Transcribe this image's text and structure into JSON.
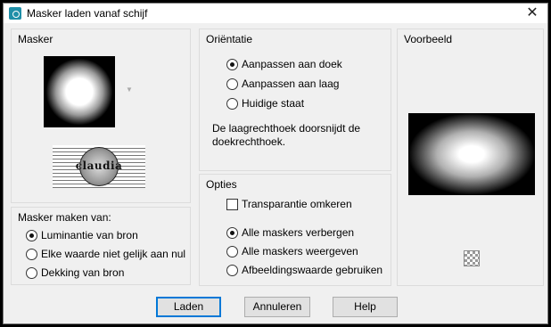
{
  "window": {
    "title": "Masker laden vanaf schijf",
    "close_symbol": "✕"
  },
  "mask_group": {
    "label": "Masker",
    "logo_text": "claudia"
  },
  "source_group": {
    "label": "Masker maken van:",
    "options": [
      "Luminantie van bron",
      "Elke waarde niet gelijk aan nul",
      "Dekking van bron"
    ],
    "selected": 0
  },
  "orientation_group": {
    "label": "Oriëntatie",
    "options": [
      "Aanpassen aan doek",
      "Aanpassen aan laag",
      "Huidige staat"
    ],
    "selected": 0,
    "description": "De laagrechthoek doorsnijdt de doekrechthoek."
  },
  "options_group": {
    "label": "Opties",
    "invert_label": "Transparantie omkeren",
    "invert_checked": false,
    "options": [
      "Alle maskers verbergen",
      "Alle maskers weergeven",
      "Afbeeldingswaarde gebruiken"
    ],
    "selected": 0
  },
  "preview_group": {
    "label": "Voorbeeld"
  },
  "buttons": {
    "load": "Laden",
    "cancel": "Annuleren",
    "help": "Help"
  }
}
